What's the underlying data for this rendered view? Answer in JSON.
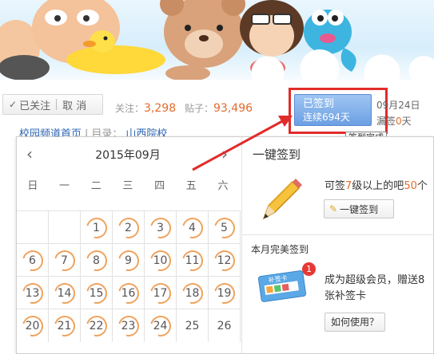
{
  "header": {
    "follow_label": "已关注",
    "unfollow_label": "取 消",
    "follows_label": "关注：",
    "follows_count": "3,298",
    "posts_label": "贴子：",
    "posts_count": "93,496"
  },
  "signin": {
    "status": "已签到",
    "streak": "连续694天",
    "date": "09月24日",
    "missed_prefix": "漏签",
    "missed_count": "0",
    "missed_suffix": "天",
    "tooltip": "签到完成"
  },
  "breadcrumb": {
    "home": "校园频道首页",
    "separator": "|",
    "dir_label": "目录：",
    "category": "山西院校"
  },
  "calendar": {
    "month_title": "2015年09月",
    "prev": "‹",
    "next": "›",
    "weekdays": [
      "日",
      "一",
      "二",
      "三",
      "四",
      "五",
      "六"
    ],
    "rows": [
      [
        "",
        "",
        "1",
        "2",
        "3",
        "4",
        "5"
      ],
      [
        "6",
        "7",
        "8",
        "9",
        "10",
        "11",
        "12"
      ],
      [
        "13",
        "14",
        "15",
        "16",
        "17",
        "18",
        "19"
      ],
      [
        "20",
        "21",
        "22",
        "23",
        "24",
        "25",
        "26"
      ]
    ],
    "signed_days": [
      "1",
      "2",
      "3",
      "4",
      "5",
      "6",
      "7",
      "8",
      "9",
      "10",
      "11",
      "12",
      "13",
      "14",
      "15",
      "16",
      "17",
      "18",
      "19",
      "20",
      "21",
      "22",
      "23",
      "24"
    ]
  },
  "side": {
    "oneclick_title": "一键签到",
    "desc_prefix": "可签",
    "desc_level": "7",
    "desc_mid": "级以上的吧",
    "desc_count": "50",
    "desc_suffix": "个",
    "oneclick_button": "一键签到",
    "perfect_title": "本月完美签到",
    "badge_count": "1",
    "card_text": "补签卡",
    "perfect_desc": "成为超级会员，赠送8张补签卡",
    "howto_button": "如何使用？"
  },
  "colors": {
    "accent_orange": "#e36b2c",
    "link_blue": "#2d64b3",
    "highlight_red": "#e22b2b"
  }
}
